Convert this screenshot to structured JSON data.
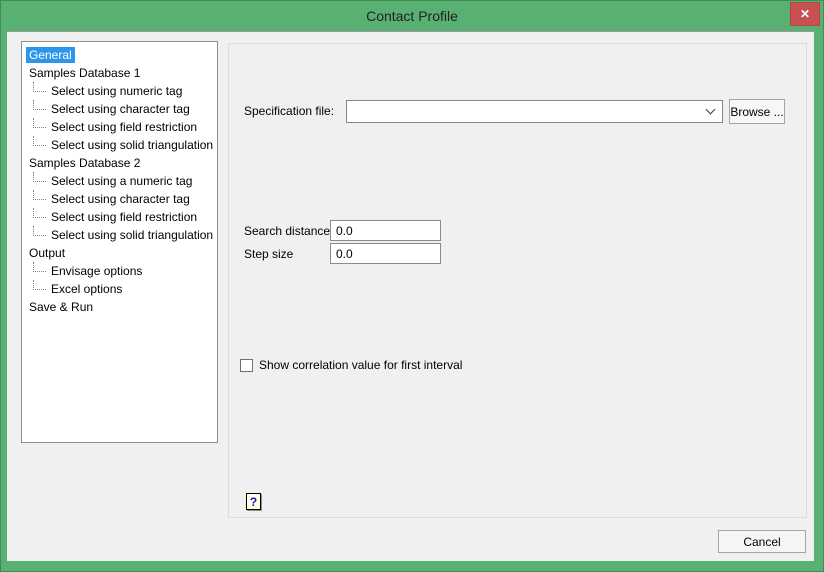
{
  "window": {
    "title": "Contact Profile"
  },
  "icons": {
    "close": "✕",
    "help": "?"
  },
  "sidebar": {
    "selected": "General",
    "items": [
      {
        "label": "General",
        "child": false,
        "selected": true
      },
      {
        "label": "Samples Database 1",
        "child": false,
        "selected": false
      },
      {
        "label": "Select using numeric tag",
        "child": true,
        "selected": false
      },
      {
        "label": "Select using character tag",
        "child": true,
        "selected": false
      },
      {
        "label": "Select using field restriction",
        "child": true,
        "selected": false
      },
      {
        "label": "Select using solid triangulation",
        "child": true,
        "selected": false
      },
      {
        "label": "Samples Database 2",
        "child": false,
        "selected": false
      },
      {
        "label": "Select using a numeric tag",
        "child": true,
        "selected": false
      },
      {
        "label": "Select using character tag",
        "child": true,
        "selected": false
      },
      {
        "label": "Select using field restriction",
        "child": true,
        "selected": false
      },
      {
        "label": "Select using solid triangulation",
        "child": true,
        "selected": false
      },
      {
        "label": "Output",
        "child": false,
        "selected": false
      },
      {
        "label": "Envisage options",
        "child": true,
        "selected": false
      },
      {
        "label": "Excel options",
        "child": true,
        "selected": false
      },
      {
        "label": "Save & Run",
        "child": false,
        "selected": false
      }
    ]
  },
  "form": {
    "specification": {
      "label": "Specification file:",
      "value": ""
    },
    "browse_label": "Browse ...",
    "search_distance": {
      "label": "Search distance",
      "value": "0.0"
    },
    "step_size": {
      "label": "Step size",
      "value": "0.0"
    },
    "correlation_checkbox": {
      "label": "Show correlation value for first interval",
      "checked": false
    }
  },
  "footer": {
    "cancel_label": "Cancel"
  },
  "colors": {
    "frame_green": "#58b172",
    "close_red": "#c75050",
    "selection_blue": "#2e96ea",
    "dialog_bg": "#f0f0f0"
  }
}
